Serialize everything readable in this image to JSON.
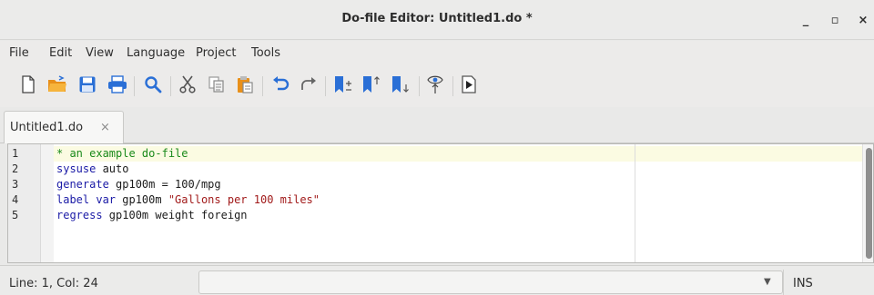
{
  "window": {
    "title": "Do-file Editor: Untitled1.do *",
    "minimize_glyph": "_",
    "maximize_glyph": "▫",
    "close_glyph": "×"
  },
  "menu": {
    "items": [
      {
        "label": "File"
      },
      {
        "label": "Edit"
      },
      {
        "label": "View"
      },
      {
        "label": "Language"
      },
      {
        "label": "Project"
      },
      {
        "label": "Tools"
      }
    ]
  },
  "toolbar": {
    "buttons": [
      {
        "icon": "new-file-icon"
      },
      {
        "icon": "open-folder-icon"
      },
      {
        "icon": "save-icon"
      },
      {
        "icon": "print-icon"
      },
      {
        "icon": "find-icon"
      },
      {
        "icon": "cut-icon"
      },
      {
        "icon": "copy-icon"
      },
      {
        "icon": "paste-icon"
      },
      {
        "icon": "undo-icon"
      },
      {
        "icon": "redo-icon"
      },
      {
        "icon": "toggle-bookmark-icon"
      },
      {
        "icon": "previous-bookmark-icon"
      },
      {
        "icon": "next-bookmark-icon"
      },
      {
        "icon": "show-file-in-viewer-icon"
      },
      {
        "icon": "execute-do-icon"
      }
    ]
  },
  "tabs": [
    {
      "label": "Untitled1.do",
      "close": "×"
    }
  ],
  "editor": {
    "line_numbers": [
      "1",
      "2",
      "3",
      "4",
      "5"
    ],
    "lines": [
      {
        "parts": [
          {
            "t": "* an example do-file",
            "style": "comment"
          }
        ]
      },
      {
        "parts": [
          {
            "t": "sysuse",
            "style": "kw"
          },
          {
            "t": " auto",
            "style": "plain"
          }
        ]
      },
      {
        "parts": [
          {
            "t": "generate",
            "style": "kw"
          },
          {
            "t": " gp100m = 100/mpg",
            "style": "plain"
          }
        ]
      },
      {
        "parts": [
          {
            "t": "label var",
            "style": "kw"
          },
          {
            "t": " gp100m ",
            "style": "plain"
          },
          {
            "t": "\"Gallons per 100 miles\"",
            "style": "string"
          }
        ]
      },
      {
        "parts": [
          {
            "t": "regress",
            "style": "kw"
          },
          {
            "t": " gp100m weight foreign",
            "style": "plain"
          }
        ]
      }
    ]
  },
  "status": {
    "position": "Line: 1, Col: 24",
    "combo_value": "",
    "mode": "INS"
  },
  "colors": {
    "comment": "#1a8a1a",
    "keyword": "#1a1aa6",
    "string": "#a11a1a",
    "current_line": "#fbfbe2",
    "accent_blue": "#2a6fd6",
    "folder_orange": "#f0a020"
  }
}
